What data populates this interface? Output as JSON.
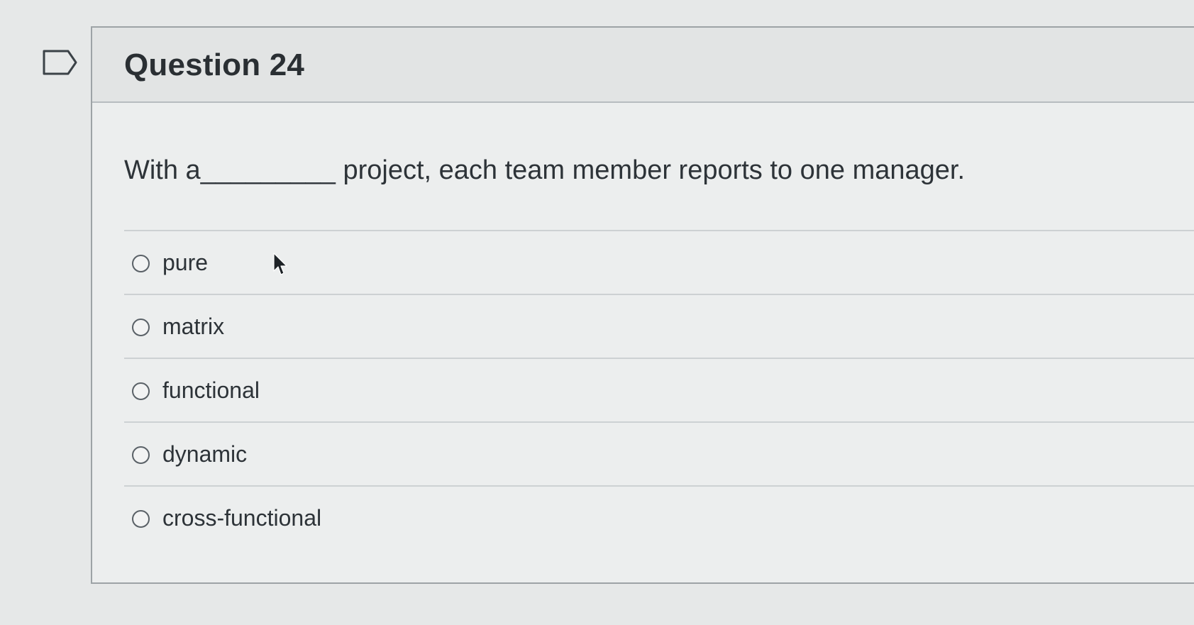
{
  "question": {
    "title": "Question 24",
    "text": "With a_________ project, each team member reports to one manager."
  },
  "answers": [
    {
      "label": "pure"
    },
    {
      "label": "matrix"
    },
    {
      "label": "functional"
    },
    {
      "label": "dynamic"
    },
    {
      "label": "cross-functional"
    }
  ],
  "icons": {
    "flag": "flag-outline-icon",
    "radio": "radio-unchecked-icon",
    "cursor": "mouse-pointer-icon"
  }
}
